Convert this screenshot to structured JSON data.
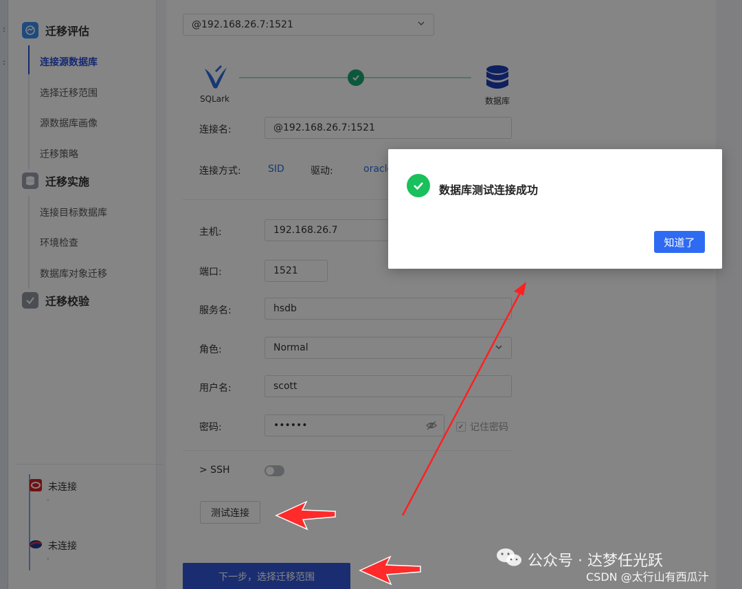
{
  "app": {
    "connection_select": "@192.168.26.7:1521"
  },
  "left_strip": {
    "symbols": [
      ":",
      ":"
    ]
  },
  "sidebar": {
    "groups": [
      {
        "label": "迁移评估",
        "items": [
          "连接源数据库",
          "选择迁移范围",
          "源数据库画像",
          "迁移策略"
        ]
      },
      {
        "label": "迁移实施",
        "items": [
          "连接目标数据库",
          "环境检查",
          "数据库对象迁移"
        ]
      },
      {
        "label": "迁移校验",
        "items": []
      }
    ],
    "active_item": "连接源数据库",
    "connections": [
      {
        "label": "未连接",
        "sub": "-",
        "icon": "oracle-icon"
      },
      {
        "label": "未连接",
        "sub": "-",
        "icon": "database-icon"
      }
    ]
  },
  "flow": {
    "source_caption": "SQLark",
    "target_caption": "数据库"
  },
  "form": {
    "conn_name_label": "连接名:",
    "conn_name_value": "@192.168.26.7:1521",
    "method_label": "连接方式:",
    "method_value": "SID",
    "driver_label": "驱动:",
    "driver_value": "oracle",
    "host_label": "主机:",
    "host_value": "192.168.26.7",
    "port_label": "端口:",
    "port_value": "1521",
    "service_label": "服务名:",
    "service_value": "hsdb",
    "role_label": "角色:",
    "role_value": "Normal",
    "user_label": "用户名:",
    "user_value": "scott",
    "password_label": "密码:",
    "password_value": "••••••",
    "remember_label": "记住密码",
    "ssh_label": "> SSH",
    "test_button": "测试连接",
    "next_button": "下一步，选择迁移范围"
  },
  "modal": {
    "title": "数据库测试连接成功",
    "ok_button": "知道了"
  },
  "watermark": {
    "line1": "公众号 · 达梦任光跃",
    "line2": "CSDN @太行山有西瓜汁"
  },
  "colors": {
    "accent": "#3357d6",
    "success": "#19c05c",
    "arrow": "#ff2020",
    "modal_button": "#2f6bf2"
  }
}
